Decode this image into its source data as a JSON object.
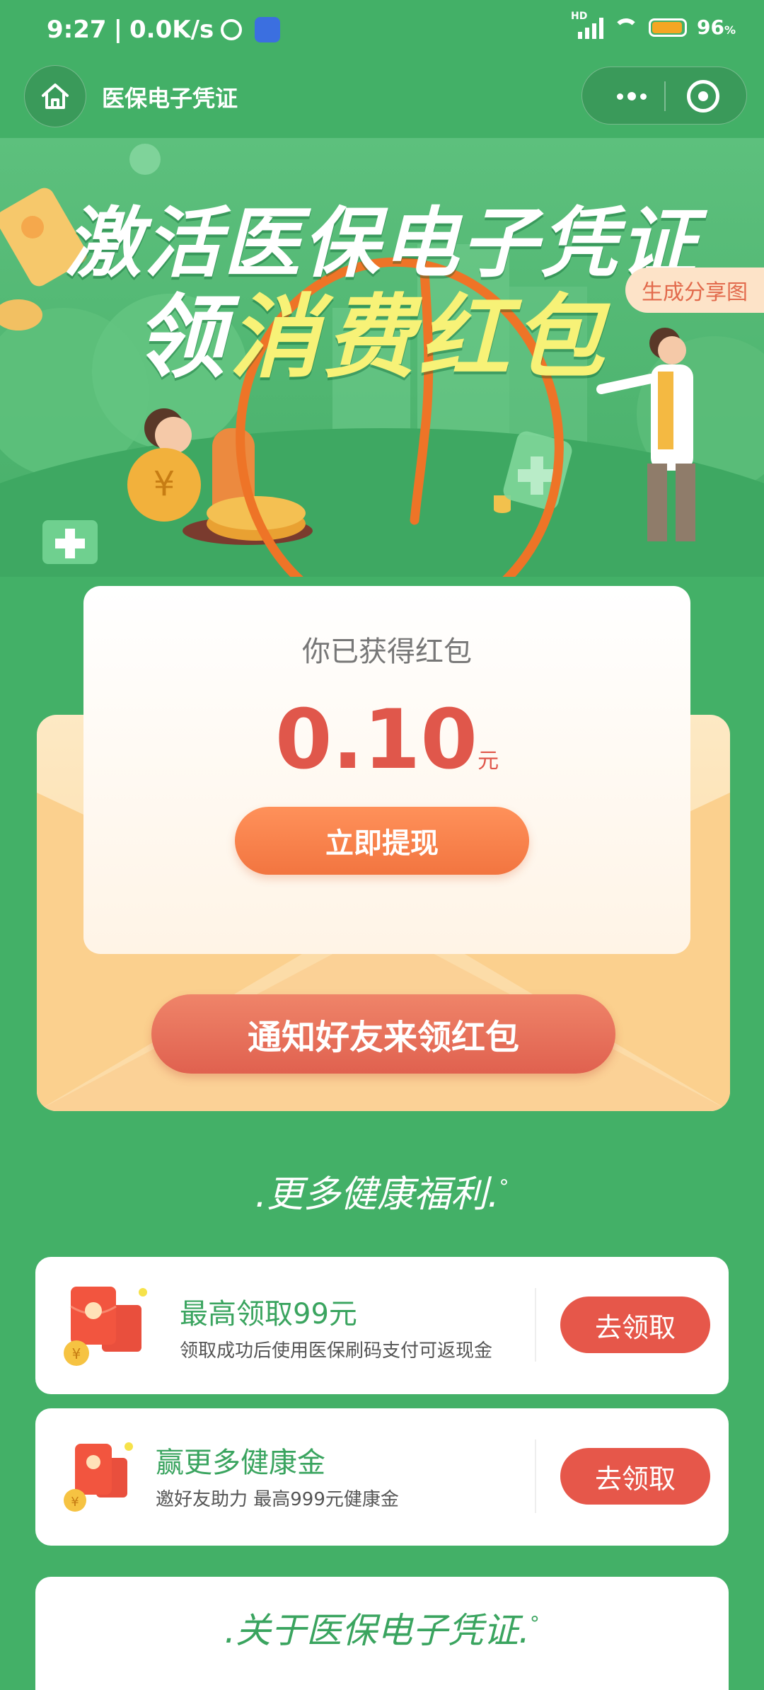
{
  "status_bar": {
    "time": "9:27",
    "network_speed": "0.0K/s",
    "signal_label": "HD",
    "battery_percent": "96",
    "battery_unit": "%",
    "battery_level": 0.96
  },
  "nav": {
    "title": "医保电子凭证"
  },
  "banner": {
    "title_line1": "激活医保电子凭证",
    "title_line2_white": "领",
    "title_line2_yellow": "消费红包",
    "share_tag": "生成分享图"
  },
  "redpacket": {
    "label": "你已获得红包",
    "amount": "0.10",
    "unit": "元",
    "withdraw_button": "立即提现",
    "notify_button": "通知好友来领红包"
  },
  "more_benefits": {
    "title": ".更多健康福利.",
    "mark": "°"
  },
  "benefits": [
    {
      "title": "最高领取99元",
      "desc": "领取成功后使用医保刷码支付可返现金",
      "button": "去领取"
    },
    {
      "title": "赢更多健康金",
      "desc": "邀好友助力 最高999元健康金",
      "button": "去领取"
    }
  ],
  "about": {
    "title": ".关于医保电子凭证.",
    "mark": "°"
  },
  "colors": {
    "background": "#43b067",
    "accent_orange": "#f27540",
    "accent_red": "#e6574a",
    "accent_green": "#3aa45f",
    "title_yellow": "#f7f277"
  }
}
